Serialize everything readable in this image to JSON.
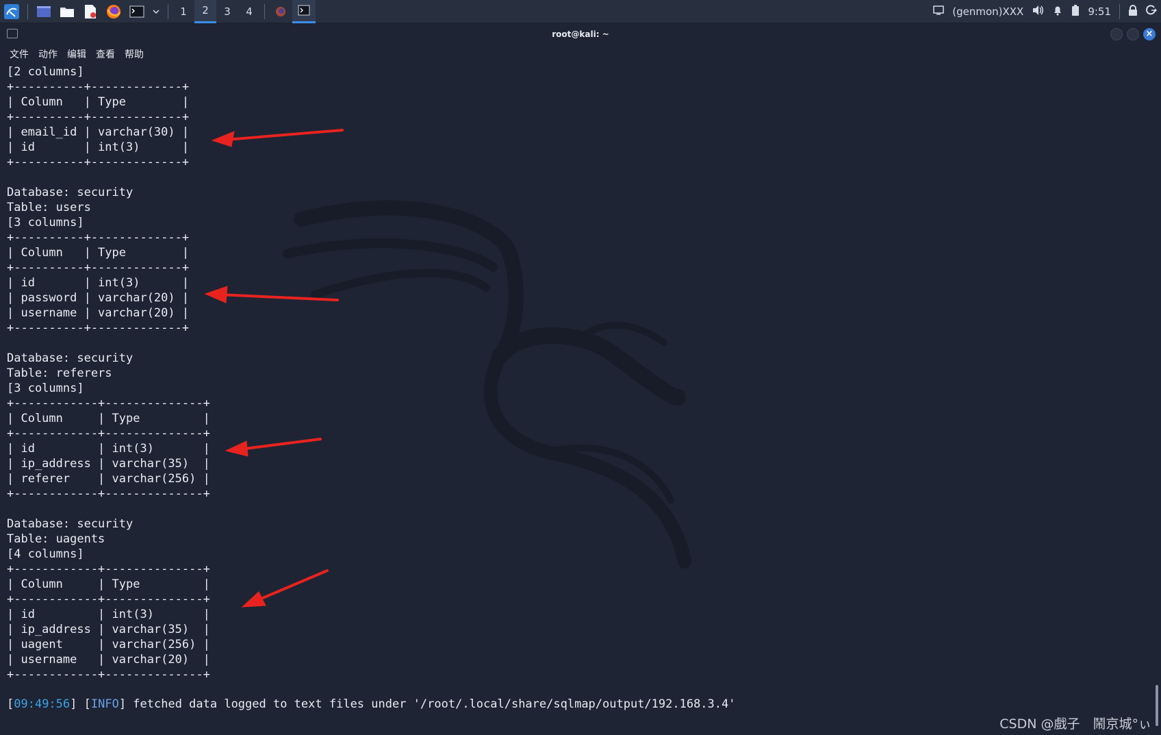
{
  "taskbar": {
    "workspaces": [
      "1",
      "2",
      "3",
      "4"
    ],
    "active_workspace": "2",
    "genmon": "(genmon)XXX",
    "clock": "9:51"
  },
  "window": {
    "title": "root@kali: ~"
  },
  "menu": [
    "文件",
    "动作",
    "编辑",
    "查看",
    "帮助"
  ],
  "terminal_lines": [
    "[2 columns]",
    "+----------+-------------+",
    "| Column   | Type        |",
    "+----------+-------------+",
    "| email_id | varchar(30) |",
    "| id       | int(3)      |",
    "+----------+-------------+",
    "",
    "Database: security",
    "Table: users",
    "[3 columns]",
    "+----------+-------------+",
    "| Column   | Type        |",
    "+----------+-------------+",
    "| id       | int(3)      |",
    "| password | varchar(20) |",
    "| username | varchar(20) |",
    "+----------+-------------+",
    "",
    "Database: security",
    "Table: referers",
    "[3 columns]",
    "+------------+--------------+",
    "| Column     | Type         |",
    "+------------+--------------+",
    "| id         | int(3)       |",
    "| ip_address | varchar(35)  |",
    "| referer    | varchar(256) |",
    "+------------+--------------+",
    "",
    "Database: security",
    "Table: uagents",
    "[4 columns]",
    "+------------+--------------+",
    "| Column     | Type         |",
    "+------------+--------------+",
    "| id         | int(3)       |",
    "| ip_address | varchar(35)  |",
    "| uagent     | varchar(256) |",
    "| username   | varchar(20)  |",
    "+------------+--------------+"
  ],
  "info_line": {
    "open_bracket": "[",
    "timestamp": "09:49:56",
    "mid": "] [",
    "level": "INFO",
    "message": "] fetched data logged to text files under '/root/.local/share/sqlmap/output/192.168.3.4'"
  },
  "watermark": "CSDN @戲子　鬧京城°ぃ",
  "colors": {
    "background": "#1e2433",
    "taskbar": "#283040",
    "accent": "#3a8ee6",
    "arrow": "#e8231f",
    "timestamp": "#3aa3e8"
  }
}
